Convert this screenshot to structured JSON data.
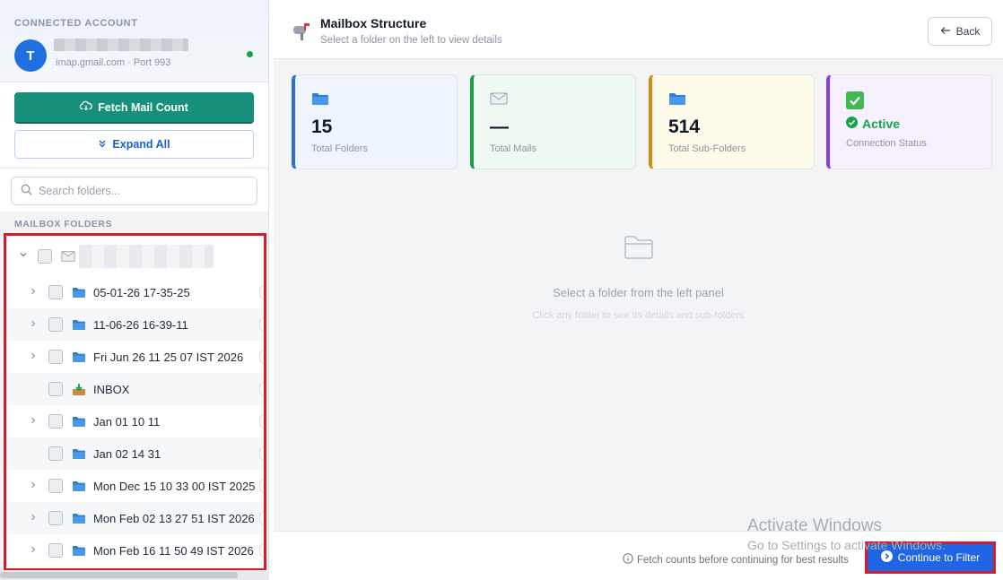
{
  "sidebar": {
    "account_label": "CONNECTED ACCOUNT",
    "avatar_letter": "T",
    "account_sub": "imap.gmail.com · Port 993",
    "fetch_label": "Fetch Mail Count",
    "expand_label": "Expand All",
    "search_placeholder": "Search folders...",
    "folders_label": "MAILBOX FOLDERS",
    "folders": [
      {
        "name": "05-01-26 17-35-25",
        "type": "folder",
        "expandable": true
      },
      {
        "name": "11-06-26 16-39-11",
        "type": "folder",
        "expandable": true
      },
      {
        "name": "Fri Jun 26 11 25 07 IST 2026",
        "type": "folder",
        "expandable": true
      },
      {
        "name": "INBOX",
        "type": "inbox",
        "expandable": false
      },
      {
        "name": "Jan 01 10 11",
        "type": "folder",
        "expandable": true
      },
      {
        "name": "Jan 02 14 31",
        "type": "folder",
        "expandable": false
      },
      {
        "name": "Mon Dec 15 10 33 00 IST 2025",
        "type": "folder",
        "expandable": true
      },
      {
        "name": "Mon Feb 02 13 27 51 IST 2026",
        "type": "folder",
        "expandable": true
      },
      {
        "name": "Mon Feb 16 11 50 49 IST 2026",
        "type": "folder",
        "expandable": true
      }
    ]
  },
  "header": {
    "title": "Mailbox Structure",
    "subtitle": "Select a folder on the left to view details",
    "back_label": "Back"
  },
  "cards": {
    "folders": {
      "value": "15",
      "label": "Total Folders"
    },
    "mails": {
      "value": "—",
      "label": "Total Mails"
    },
    "subfolders": {
      "value": "514",
      "label": "Total Sub-Folders"
    },
    "status": {
      "value": "Active",
      "label": "Connection Status"
    }
  },
  "empty": {
    "title": "Select a folder from the left panel",
    "sub": "Click any folder to see its details and sub-folders"
  },
  "footer": {
    "hint": "Fetch counts before continuing for best results",
    "continue_label": "Continue to Filter"
  },
  "watermark": {
    "line1": "Activate Windows",
    "line2": "Go to Settings to activate Windows."
  },
  "colors": {
    "primary": "#1f65e6",
    "fetch": "#16907a",
    "active": "#16a34a",
    "highlight": "#d21d2e"
  }
}
